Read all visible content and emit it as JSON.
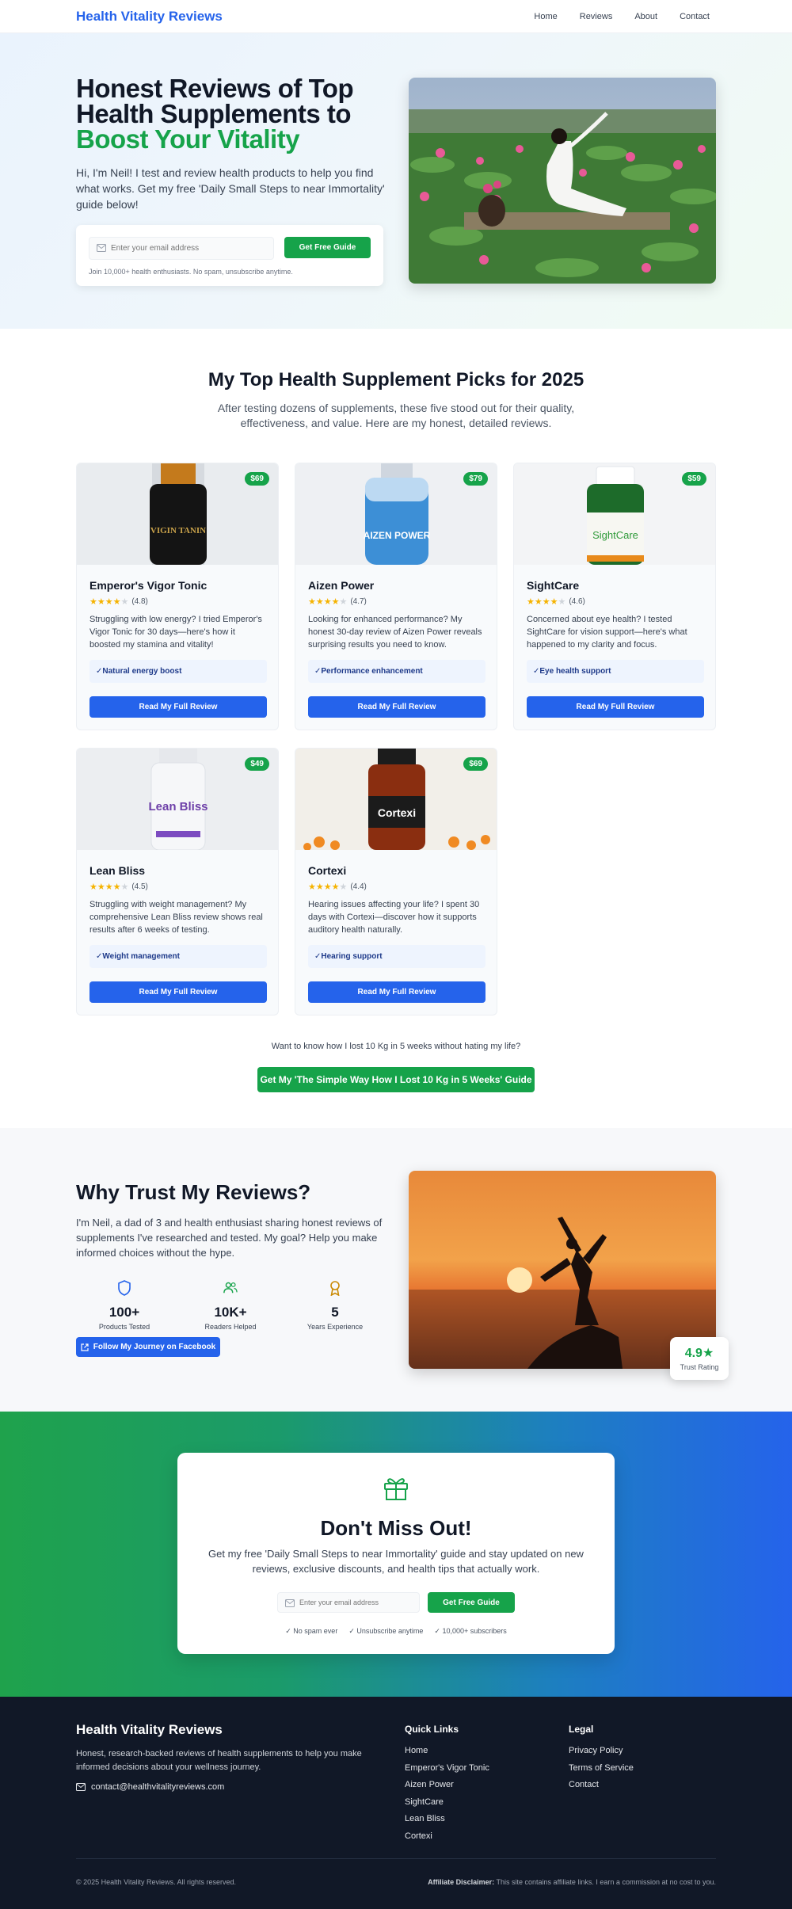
{
  "nav": {
    "brand": "Health Vitality Reviews",
    "links": [
      "Home",
      "Reviews",
      "About",
      "Contact"
    ]
  },
  "hero": {
    "title_line1": "Honest Reviews of Top",
    "title_line2": "Health Supplements to",
    "title_highlight": "Boost Your Vitality",
    "subtitle": "Hi, I'm Neil! I test and review health products to help you find what works. Get my free 'Daily Small Steps to near Immortality' guide below!",
    "email_placeholder": "Enter your email address",
    "cta": "Get Free Guide",
    "note": "Join 10,000+ health enthusiasts. No spam, unsubscribe anytime."
  },
  "picks": {
    "title": "My Top Health Supplement Picks for 2025",
    "subtitle": "After testing dozens of supplements, these five stood out for their quality, effectiveness, and value. Here are my honest, detailed reviews.",
    "button_label": "Read My Full Review",
    "products": [
      {
        "name": "Emperor's Vigor Tonic",
        "price": "$69",
        "rating": "(4.8)",
        "stars": 4,
        "desc": "Struggling with low energy? I tried Emperor's Vigor Tonic for 30 days—here's how it boosted my stamina and vitality!",
        "benefit": "✓Natural energy boost",
        "label_text": "VIGIN TANIN"
      },
      {
        "name": "Aizen Power",
        "price": "$79",
        "rating": "(4.7)",
        "stars": 4,
        "desc": "Looking for enhanced performance? My honest 30-day review of Aizen Power reveals surprising results you need to know.",
        "benefit": "✓Performance enhancement",
        "label_text": "AIZEN POWER"
      },
      {
        "name": "SightCare",
        "price": "$59",
        "rating": "(4.6)",
        "stars": 4,
        "desc": "Concerned about eye health? I tested SightCare for vision support—here's what happened to my clarity and focus.",
        "benefit": "✓Eye health support",
        "label_text": "SightCare"
      },
      {
        "name": "Lean Bliss",
        "price": "$49",
        "rating": "(4.5)",
        "stars": 4,
        "desc": "Struggling with weight management? My comprehensive Lean Bliss review shows real results after 6 weeks of testing.",
        "benefit": "✓Weight management",
        "label_text": "Lean Bliss"
      },
      {
        "name": "Cortexi",
        "price": "$69",
        "rating": "(4.4)",
        "stars": 4,
        "desc": "Hearing issues affecting your life? I spent 30 days with Cortexi—discover how it supports auditory health naturally.",
        "benefit": "✓Hearing support",
        "label_text": "Cortexi"
      }
    ],
    "guide_question": "Want to know how I lost 10 Kg in 5 weeks without hating my life?",
    "guide_cta": "Get My 'The Simple Way How I Lost 10 Kg in 5 Weeks' Guide"
  },
  "trust": {
    "title": "Why Trust My Reviews?",
    "text": "I'm Neil, a dad of 3 and health enthusiast sharing honest reviews of supplements I've researched and tested. My goal? Help you make informed choices without the hype.",
    "stats": [
      {
        "value": "100+",
        "label": "Products Tested",
        "icon": "shield-icon"
      },
      {
        "value": "10K+",
        "label": "Readers Helped",
        "icon": "users-icon"
      },
      {
        "value": "5",
        "label": "Years Experience",
        "icon": "award-icon"
      }
    ],
    "facebook_cta": "Follow My Journey on Facebook",
    "badge_value": "4.9★",
    "badge_label": "Trust Rating"
  },
  "newsletter": {
    "title": "Don't Miss Out!",
    "subtitle": "Get my free 'Daily Small Steps to near Immortality' guide and stay updated on new reviews, exclusive discounts, and health tips that actually work.",
    "email_placeholder": "Enter your email address",
    "cta": "Get Free Guide",
    "perks": [
      "✓ No spam ever",
      "✓ Unsubscribe anytime",
      "✓ 10,000+ subscribers"
    ]
  },
  "footer": {
    "brand": "Health Vitality Reviews",
    "desc": "Honest, research-backed reviews of health supplements to help you make informed decisions about your wellness journey.",
    "email": "contact@healthvitalityreviews.com",
    "quick_links_title": "Quick Links",
    "quick_links": [
      "Home",
      "Emperor's Vigor Tonic",
      "Aizen Power",
      "SightCare",
      "Lean Bliss",
      "Cortexi"
    ],
    "legal_title": "Legal",
    "legal_links": [
      "Privacy Policy",
      "Terms of Service",
      "Contact"
    ],
    "copyright": "© 2025 Health Vitality Reviews. All rights reserved.",
    "disclaimer_label": "Affiliate Disclaimer:",
    "disclaimer_text": "This site contains affiliate links. I earn a commission at no cost to you."
  },
  "colors": {
    "brand_blue": "#2563eb",
    "accent_green": "#16a34a",
    "footer_bg": "#111827"
  }
}
